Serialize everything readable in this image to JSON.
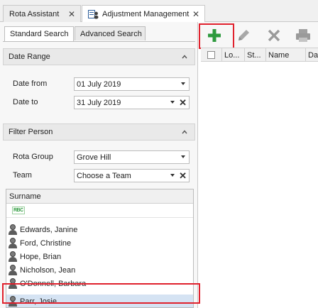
{
  "doc_tabs": [
    {
      "label": "Rota Assistant",
      "close": "✕"
    },
    {
      "label": "Adjustment Management",
      "close": "✕"
    }
  ],
  "search_tabs": {
    "standard": "Standard Search",
    "advanced": "Advanced Search"
  },
  "date_range": {
    "header": "Date Range",
    "from_label": "Date from",
    "from_value": "01 July 2019",
    "to_label": "Date to",
    "to_value": "31 July 2019"
  },
  "filter_person": {
    "header": "Filter Person",
    "rota_group_label": "Rota Group",
    "rota_group_value": "Grove Hill",
    "team_label": "Team",
    "team_value": "Choose a Team"
  },
  "person_grid": {
    "column": "Surname",
    "filter_icon": "RBC",
    "rows": [
      "Edwards, Janine",
      "Ford, Christine",
      "Hope, Brian",
      "Nicholson, Jean",
      "O'Donnell, Barbara",
      "Parr, Josie"
    ],
    "selected": "Parr, Josie"
  },
  "toolbar": {
    "add_icon": "plus-icon",
    "edit_icon": "pencil-icon",
    "delete_icon": "delete-x-icon",
    "print_icon": "printer-icon"
  },
  "adjustment_grid": {
    "columns": [
      "Lo...",
      "St...",
      "Name",
      "Da"
    ]
  },
  "colors": {
    "add_green": "#2e9a3e",
    "highlight_red": "#e0212d",
    "selected_row": "#d5e3f3"
  }
}
